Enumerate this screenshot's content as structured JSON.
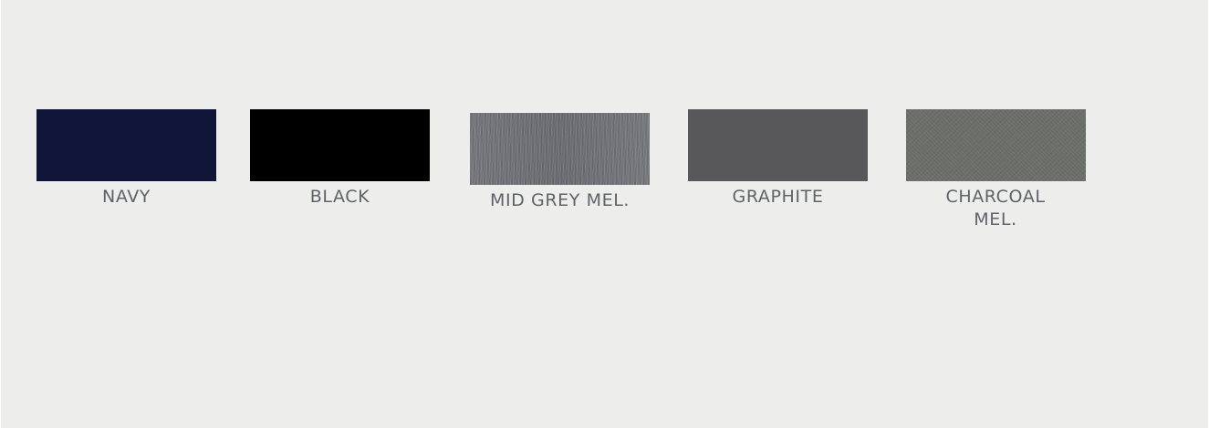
{
  "swatches": [
    {
      "label": "NAVY",
      "color": "#11153a"
    },
    {
      "label": "BLACK",
      "color": "#000000"
    },
    {
      "label": "MID GREY MEL.",
      "color": "#6f7176"
    },
    {
      "label": "GRAPHITE",
      "color": "#58585a"
    },
    {
      "label": "CHARCOAL MEL.",
      "color": "#6b6e69"
    }
  ]
}
